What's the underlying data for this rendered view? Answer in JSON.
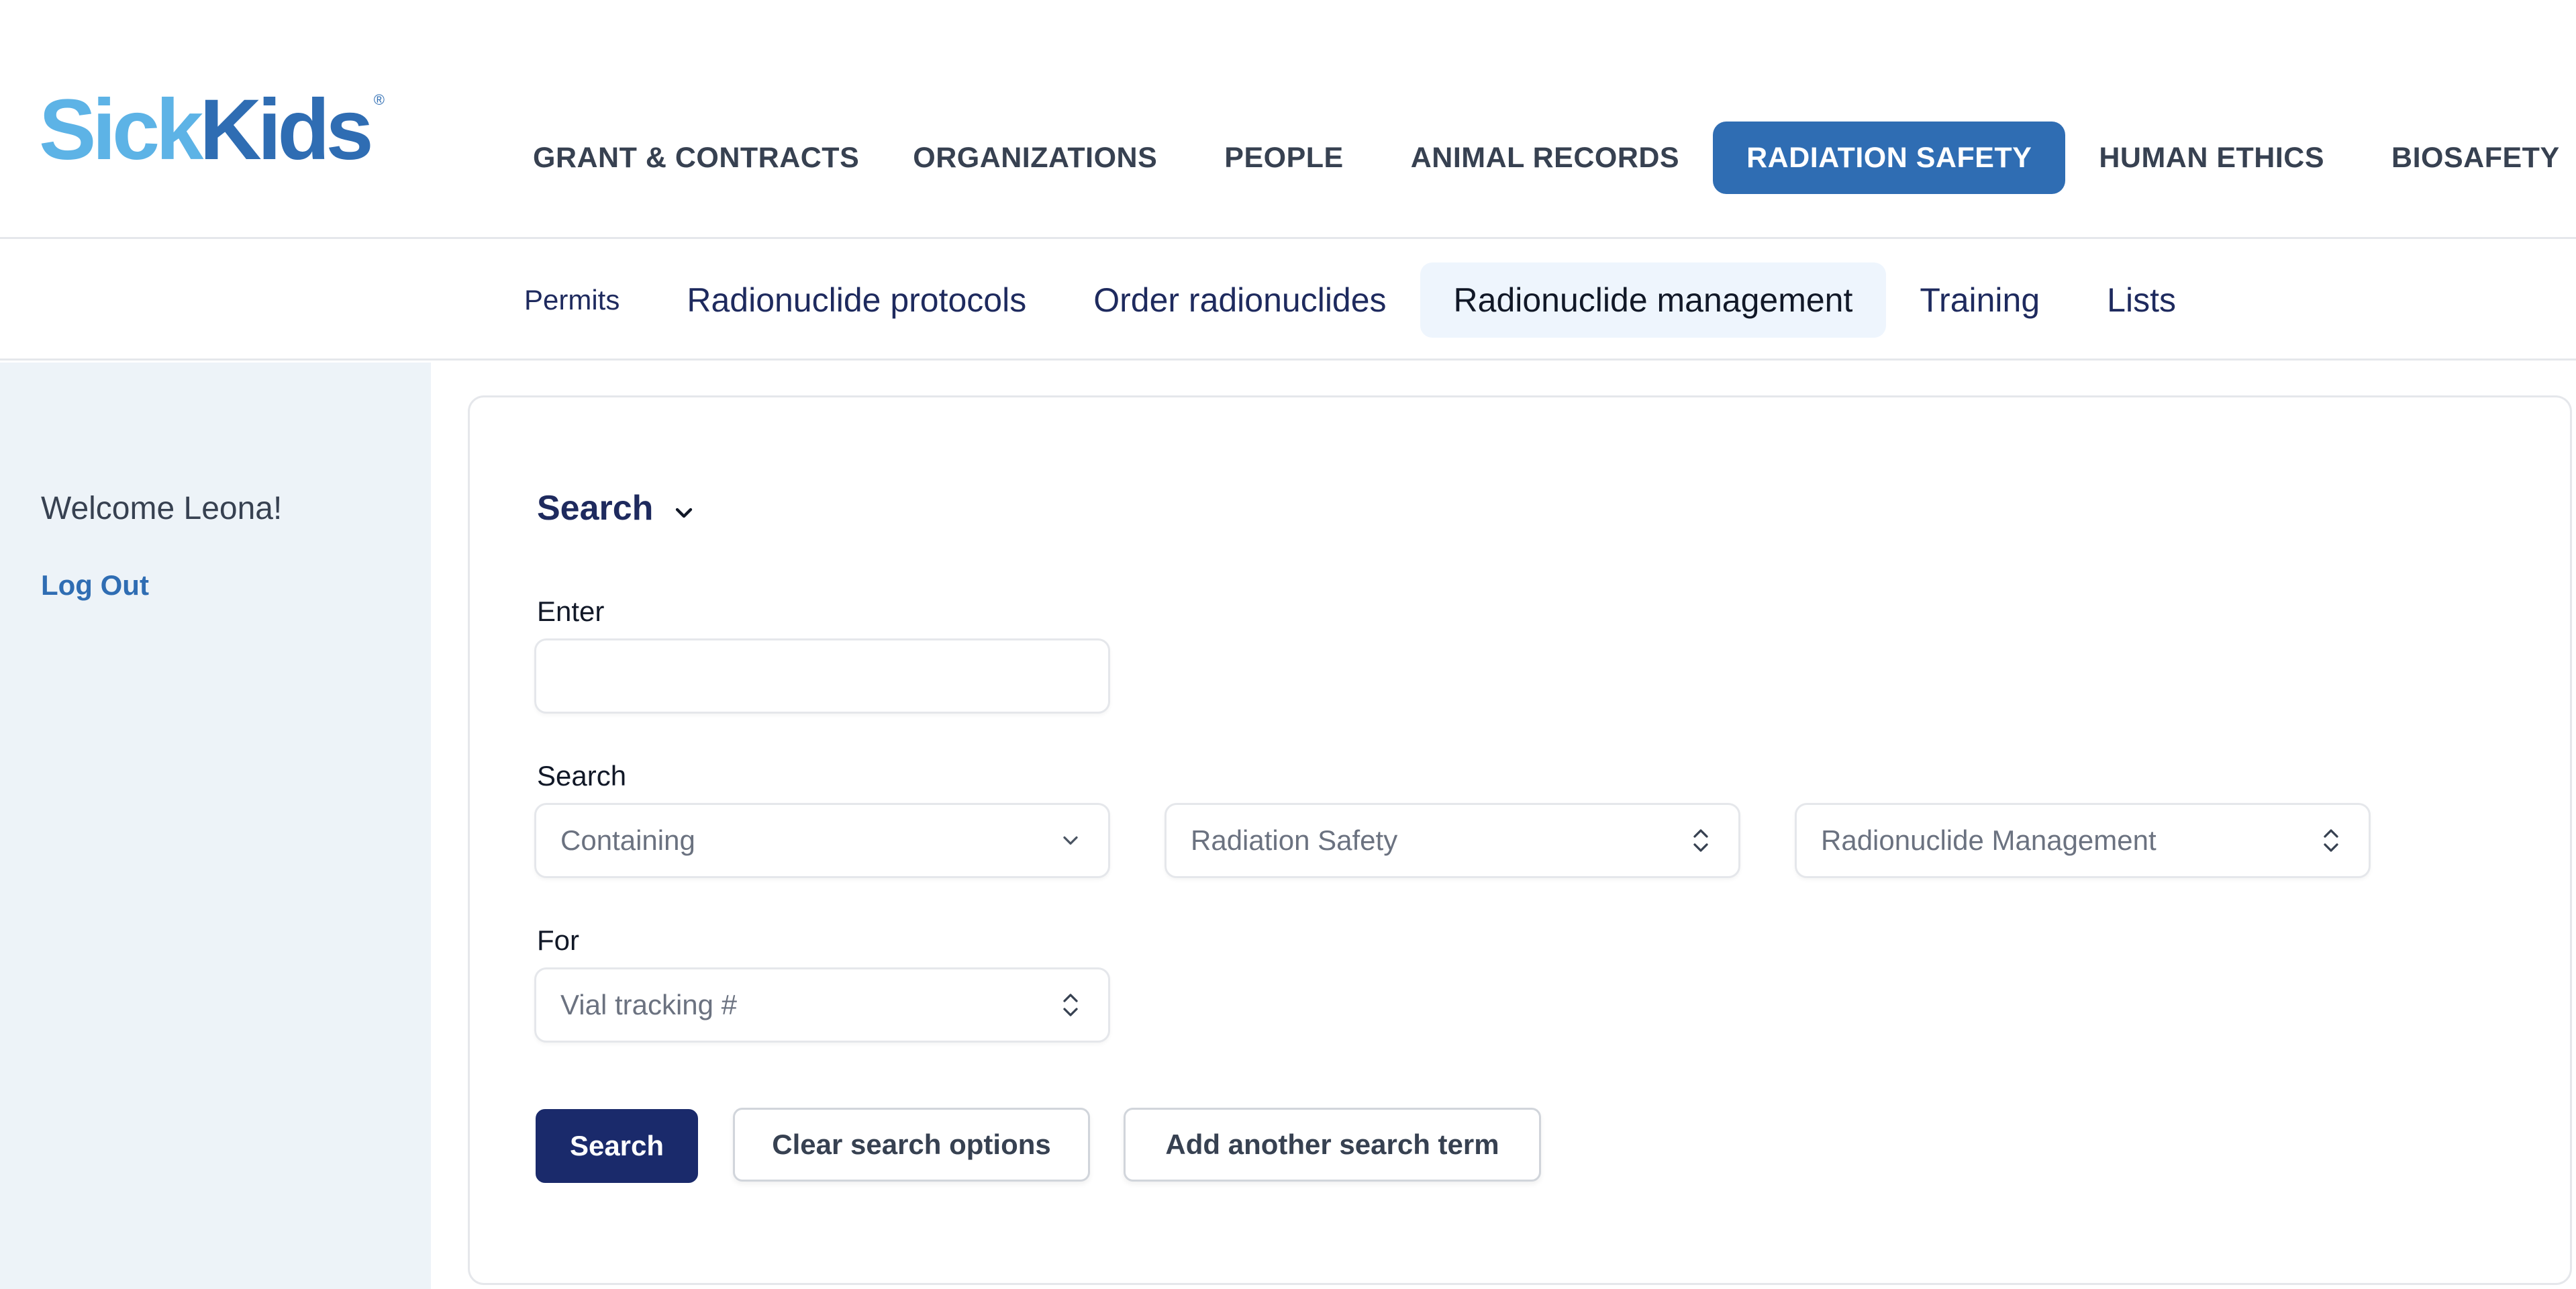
{
  "header": {
    "logo_left": "Sick",
    "logo_right": "Kids",
    "logo_mark": "®",
    "nav": [
      {
        "label": "GRANT & CONTRACTS",
        "active": false
      },
      {
        "label": "ORGANIZATIONS",
        "active": false
      },
      {
        "label": "PEOPLE",
        "active": false
      },
      {
        "label": "ANIMAL RECORDS",
        "active": false
      },
      {
        "label": "RADIATION SAFETY",
        "active": true
      },
      {
        "label": "HUMAN ETHICS",
        "active": false
      },
      {
        "label": "BIOSAFETY",
        "active": false
      }
    ]
  },
  "subnav": [
    {
      "label": "Permits",
      "active": false
    },
    {
      "label": "Radionuclide protocols",
      "active": false
    },
    {
      "label": "Order radionuclides",
      "active": false
    },
    {
      "label": "Radionuclide management",
      "active": true
    },
    {
      "label": "Training",
      "active": false
    },
    {
      "label": "Lists",
      "active": false
    }
  ],
  "sidebar": {
    "welcome": "Welcome Leona!",
    "logout": "Log Out"
  },
  "search": {
    "heading": "Search",
    "enter_label": "Enter",
    "enter_value": "",
    "search_label": "Search",
    "match_select": "Containing",
    "module_select": "Radiation Safety",
    "section_select": "Radionuclide Management",
    "for_label": "For",
    "for_select": "Vial tracking #",
    "buttons": {
      "search": "Search",
      "clear": "Clear search options",
      "add": "Add another search term"
    }
  },
  "colors": {
    "brand_blue": "#2f6db3",
    "logo_light_blue": "#5db3e6",
    "navy": "#1a2a6b",
    "sidebar_bg": "#edf3f8",
    "active_subnav_bg": "#eef5fd"
  },
  "icons": {
    "heading_toggle": "chevron-down-icon",
    "dropdown": "chevron-down-icon",
    "sort_select": "chevron-up-down-icon"
  }
}
